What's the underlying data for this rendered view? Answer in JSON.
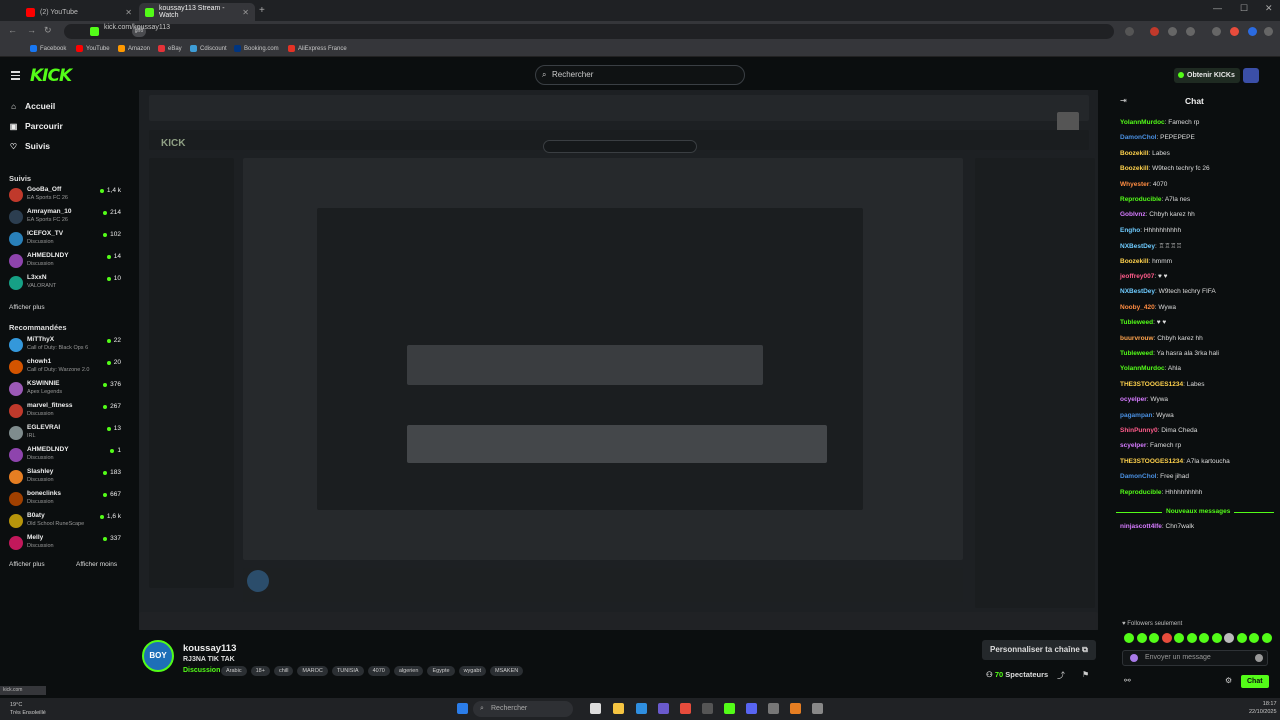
{
  "browser": {
    "tabs": [
      {
        "title": "(2) YouTube",
        "favicon_color": "#ff0000"
      },
      {
        "title": "koussay113 Stream - Watch",
        "favicon_color": "#53fc18"
      }
    ],
    "url": "kick.com/koussay113",
    "tune_label": "grfo",
    "bookmarks": [
      {
        "label": "Facebook",
        "color": "#1877f2"
      },
      {
        "label": "YouTube",
        "color": "#ff0000"
      },
      {
        "label": "Amazon",
        "color": "#ff9900"
      },
      {
        "label": "eBay",
        "color": "#e53238"
      },
      {
        "label": "Cdiscount",
        "color": "#3e9dd6"
      },
      {
        "label": "Booking.com",
        "color": "#003580"
      },
      {
        "label": "AliExpress France",
        "color": "#e43225"
      }
    ]
  },
  "header": {
    "logo": "KICK",
    "search_placeholder": "Rechercher",
    "get_kicks": "Obtenir KICKs"
  },
  "sidebar": {
    "nav": [
      {
        "label": "Accueil",
        "icon": "home-icon"
      },
      {
        "label": "Parcourir",
        "icon": "compass-icon"
      },
      {
        "label": "Suivis",
        "icon": "heart-icon"
      }
    ],
    "followed_title": "Suivis",
    "followed": [
      {
        "name": "GooBa_Off",
        "game": "EA Sports FC 26",
        "viewers": "1,4 k",
        "color": "#c0392b"
      },
      {
        "name": "Amrayman_10",
        "game": "EA Sports FC 26",
        "viewers": "214",
        "color": "#2c3e50"
      },
      {
        "name": "ICEFOX_TV",
        "game": "Discussion",
        "viewers": "102",
        "color": "#2980b9"
      },
      {
        "name": "AHMEDLNDY",
        "game": "Discussion",
        "viewers": "14",
        "color": "#8e44ad"
      },
      {
        "name": "L3xxN",
        "game": "VALORANT",
        "viewers": "10",
        "color": "#16a085"
      }
    ],
    "show_more_1": "Afficher plus",
    "recommended_title": "Recommandées",
    "recommended": [
      {
        "name": "MiTThyX",
        "game": "Call of Duty: Black Ops 6",
        "viewers": "22",
        "color": "#3498db"
      },
      {
        "name": "chowh1",
        "game": "Call of Duty: Warzone 2.0",
        "viewers": "20",
        "color": "#d35400"
      },
      {
        "name": "KSWINNIE",
        "game": "Apex Legends",
        "viewers": "376",
        "color": "#9b59b6"
      },
      {
        "name": "marvel_fitness",
        "game": "Discussion",
        "viewers": "267",
        "color": "#c0392b"
      },
      {
        "name": "EGLEVRAI",
        "game": "IRL",
        "viewers": "13",
        "color": "#7f8c8d"
      },
      {
        "name": "AHMEDLNDY",
        "game": "Discussion",
        "viewers": "1",
        "color": "#8e44ad"
      },
      {
        "name": "Slashley",
        "game": "Discussion",
        "viewers": "183",
        "color": "#e67e22"
      },
      {
        "name": "boneclinks",
        "game": "Discussion",
        "viewers": "667",
        "color": "#a04000"
      },
      {
        "name": "B0aty",
        "game": "Old School RuneScape",
        "viewers": "1,6 k",
        "color": "#b7950b"
      },
      {
        "name": "Melly",
        "game": "Discussion",
        "viewers": "337",
        "color": "#c2185b"
      }
    ],
    "show_more_2": "Afficher plus",
    "show_less": "Afficher moins"
  },
  "stream": {
    "channel": "koussay113",
    "avatar_text": "BOY",
    "title": "RJ3NA TIK TAK",
    "category": "Discussion",
    "tags": [
      "Arabic",
      "18+",
      "chill",
      "MAROC",
      "TUNISIA",
      "4070",
      "algerien",
      "Egypte",
      "wygabt",
      "MSAKEN"
    ],
    "customize": "Personnaliser ta chaîne",
    "viewers": "70",
    "viewers_label": "Spectateurs"
  },
  "chat": {
    "title": "Chat",
    "messages": [
      {
        "user": "YolannMurdoc",
        "text": "Famech rp",
        "color": "#53fc18"
      },
      {
        "user": "DamonChol",
        "text": "PEPEPEPE",
        "color": "#4a90e2"
      },
      {
        "user": "Boozekill",
        "text": "Labes",
        "color": "#ffd24d"
      },
      {
        "user": "Boozekill",
        "text": "W9tech techry fc 26",
        "color": "#ffd24d"
      },
      {
        "user": "Whyester",
        "text": "4070",
        "color": "#ff8c42"
      },
      {
        "user": "Reproducible",
        "text": "A7la nes",
        "color": "#53fc18"
      },
      {
        "user": "Goblvnz",
        "text": "Chbyh karez hh",
        "color": "#d67bff"
      },
      {
        "user": "Engho",
        "text": "Hhhhhhhhhh",
        "color": "#6ecbff"
      },
      {
        "user": "NXBestDey",
        "text": "♖♖♖♖",
        "color": "#6ecbff"
      },
      {
        "user": "Boozekill",
        "text": "hmmm",
        "color": "#ffd24d"
      },
      {
        "user": "jeoffrey007",
        "text": "♥ ♥",
        "color": "#ff5b8a"
      },
      {
        "user": "NXBestDey",
        "text": "W9tech techry FIFA",
        "color": "#6ecbff"
      },
      {
        "user": "Nooby_420",
        "text": "Wywa",
        "color": "#ff8c42"
      },
      {
        "user": "Tubleweed",
        "text": "♥ ♥",
        "color": "#53fc18"
      },
      {
        "user": "buurvrouw",
        "text": "Chbyh karez hh",
        "color": "#ffa34d"
      },
      {
        "user": "Tubleweed",
        "text": "Ya hasra ala 3rka hali",
        "color": "#53fc18"
      },
      {
        "user": "YolannMurdoc",
        "text": "Ahla",
        "color": "#53fc18"
      },
      {
        "user": "THE3STOOGES1234",
        "text": "Labes",
        "color": "#ffd24d"
      },
      {
        "user": "ocyelper",
        "text": "Wywa",
        "color": "#d67bff"
      },
      {
        "user": "pagampan",
        "text": "Wywa",
        "color": "#4a90e2"
      },
      {
        "user": "ShinPunny0",
        "text": "Dima Cheda",
        "color": "#ff5b8a"
      },
      {
        "user": "scyelper",
        "text": "Famech rp",
        "color": "#d67bff"
      },
      {
        "user": "THE3STOOGES1234",
        "text": "A7la kartoucha",
        "color": "#ffd24d"
      },
      {
        "user": "DamonChol",
        "text": "Free jihad",
        "color": "#4a90e2"
      },
      {
        "user": "Reproducible",
        "text": "Hhhhhhhhhh",
        "color": "#53fc18"
      }
    ],
    "new_messages": "Nouveaux messages",
    "after_new": [
      {
        "user": "ninjascott4lfe",
        "text": "Chn7walk",
        "color": "#d67bff"
      }
    ],
    "followers_only": "Followers seulement",
    "input_placeholder": "Envoyer un message",
    "send_label": "Chat"
  },
  "taskbar": {
    "search_placeholder": "Rechercher",
    "weather_temp": "19°C",
    "weather_desc": "Très Ensoleillé",
    "time": "18:17",
    "date": "22/10/2025"
  },
  "colors": {
    "accent": "#53fc18",
    "background": "#0b0e0f"
  }
}
